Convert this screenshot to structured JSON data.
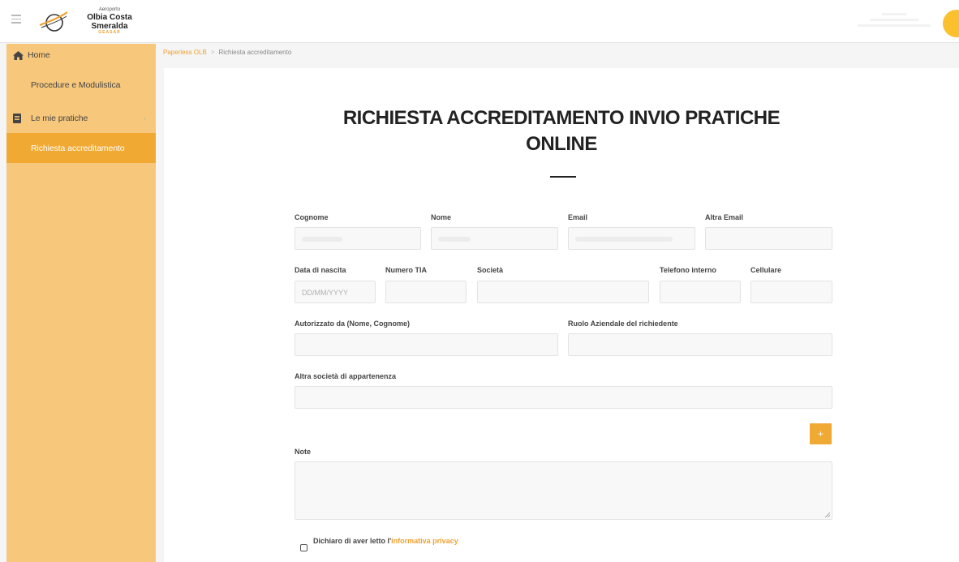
{
  "header": {
    "logo_small": "Aeroporto",
    "logo_main": "Olbia Costa Smeralda",
    "logo_sub": "GEASAR"
  },
  "sidebar": {
    "items": [
      {
        "label": "Home",
        "icon": "home-icon"
      },
      {
        "label": "Procedure e Modulistica"
      },
      {
        "label": "Le mie pratiche",
        "icon": "document-icon"
      },
      {
        "label": "Richiesta accreditamento",
        "active": true
      }
    ]
  },
  "breadcrumb": {
    "root": "Paperless OLB",
    "separator": ">",
    "current": "Richiesta accreditamento"
  },
  "form": {
    "title_line1": "RICHIESTA ACCREDITAMENTO INVIO PRATICHE",
    "title_line2": "ONLINE",
    "labels": {
      "cognome": "Cognome",
      "nome": "Nome",
      "email": "Email",
      "altra_email": "Altra Email",
      "data_nascita": "Data di nascita",
      "numero_tia": "Numero TIA",
      "societa": "Società",
      "telefono_interno": "Telefono interno",
      "cellulare": "Cellulare",
      "autorizzato_da": "Autorizzato da (Nome, Cognome)",
      "ruolo": "Ruolo Aziendale del richiedente",
      "altra_societa": "Altra società di appartenenza",
      "note": "Note"
    },
    "placeholders": {
      "data_nascita": "DD/MM/YYYY"
    },
    "add_button": "+",
    "privacy_text": "Dichiaro di aver letto l'",
    "privacy_link": "informativa privacy"
  },
  "colors": {
    "accent": "#f0a933",
    "sidebar_bg": "#f7c77c",
    "avatar": "#fbc02d"
  }
}
